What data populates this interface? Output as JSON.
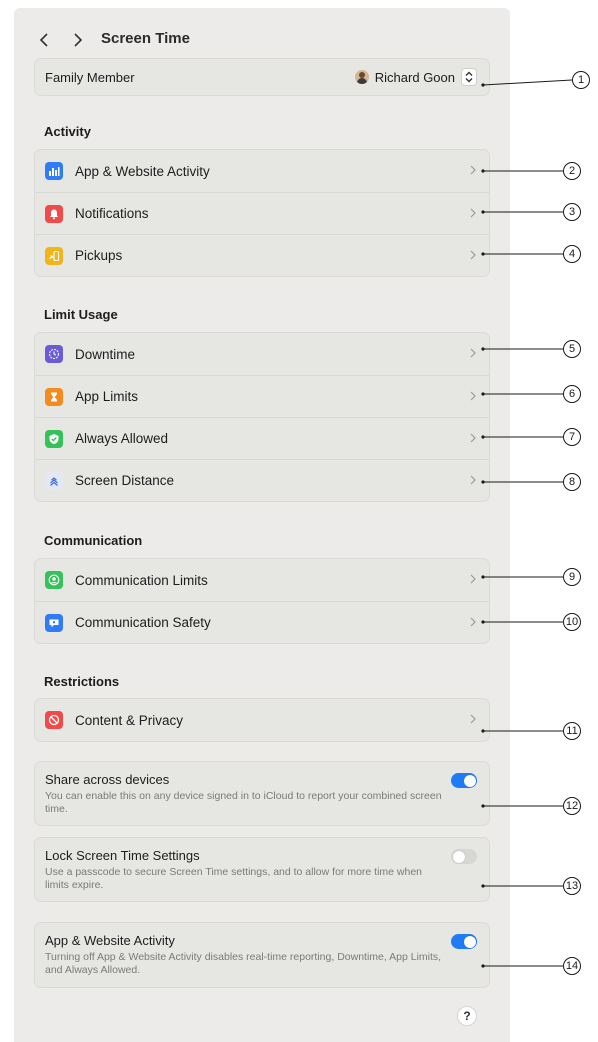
{
  "nav": {
    "title": "Screen Time"
  },
  "family": {
    "label": "Family Member",
    "member_name": "Richard Goon"
  },
  "sections": {
    "activity": "Activity",
    "limit_usage": "Limit Usage",
    "communication": "Communication",
    "restrictions": "Restrictions"
  },
  "activity_items": [
    {
      "label": "App & Website Activity",
      "icon": "bar-chart-icon",
      "color": "#2f7cf6"
    },
    {
      "label": "Notifications",
      "icon": "bell-icon",
      "color": "#f04a4a"
    },
    {
      "label": "Pickups",
      "icon": "pickup-icon",
      "color": "#f1b51b"
    }
  ],
  "limit_items": [
    {
      "label": "Downtime",
      "icon": "downtime-icon",
      "color": "#6a5bd6"
    },
    {
      "label": "App Limits",
      "icon": "hourglass-icon",
      "color": "#f58a1f"
    },
    {
      "label": "Always Allowed",
      "icon": "checkmark-shield-icon",
      "color": "#36c15a"
    },
    {
      "label": "Screen Distance",
      "icon": "screen-distance-icon",
      "color": "#e3e8f3"
    }
  ],
  "communication_items": [
    {
      "label": "Communication Limits",
      "icon": "person-circle-icon",
      "color": "#36c15a"
    },
    {
      "label": "Communication Safety",
      "icon": "chat-bubble-icon",
      "color": "#2f7cf6"
    }
  ],
  "restriction_items": [
    {
      "label": "Content & Privacy",
      "icon": "no-entry-icon",
      "color": "#f04a4a"
    }
  ],
  "toggles": [
    {
      "title": "Share across devices",
      "desc": "You can enable this on any device signed in to iCloud to report your combined screen time.",
      "on": true
    },
    {
      "title": "Lock Screen Time Settings",
      "desc": "Use a passcode to secure Screen Time settings, and to allow for more time when limits expire.",
      "on": false
    },
    {
      "title": "App & Website Activity",
      "desc": "Turning off App & Website Activity disables real-time reporting, Downtime, App Limits, and Always Allowed.",
      "on": true
    }
  ],
  "help": "?",
  "callouts": [
    "1",
    "2",
    "3",
    "4",
    "5",
    "6",
    "7",
    "8",
    "9",
    "10",
    "11",
    "12",
    "13",
    "14"
  ]
}
